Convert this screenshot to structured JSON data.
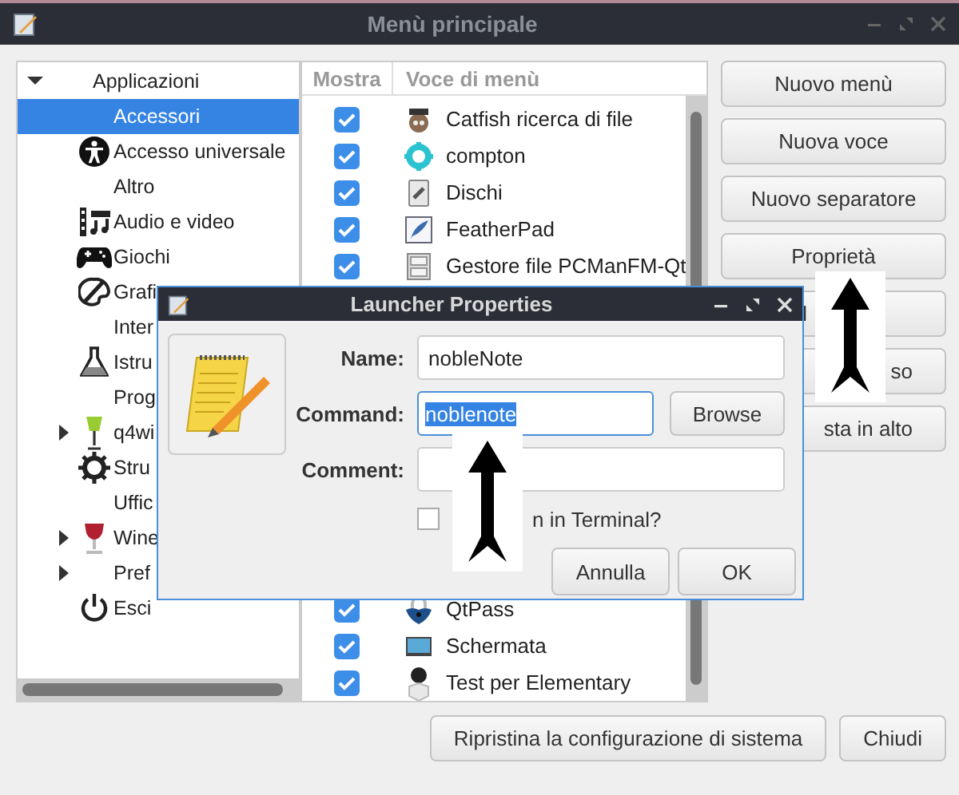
{
  "window": {
    "title": "Menù principale"
  },
  "tree": [
    {
      "label": "Applicazioni",
      "expanded": true,
      "children": [
        {
          "label": "Accessori",
          "selected": true
        },
        {
          "label": "Accesso universale",
          "selected": false
        },
        {
          "label": "Altro",
          "selected": false
        },
        {
          "label": "Audio e video",
          "selected": false
        },
        {
          "label": "Giochi",
          "selected": false
        },
        {
          "label": "Grafi",
          "selected": false
        },
        {
          "label": "Inter",
          "selected": false
        },
        {
          "label": "Istru",
          "selected": false
        },
        {
          "label": "Prog",
          "selected": false
        },
        {
          "label": "q4wi",
          "selected": false,
          "expanded": false
        },
        {
          "label": "Stru",
          "selected": false
        },
        {
          "label": "Uffic",
          "selected": false
        },
        {
          "label": "Wine",
          "selected": false,
          "expanded": false
        },
        {
          "label": "Pref",
          "selected": false,
          "expanded": false
        },
        {
          "label": "Esci",
          "selected": false
        }
      ]
    }
  ],
  "table": {
    "columns": [
      "Mostra",
      "Voce di menù"
    ],
    "rows_top": [
      {
        "label": "Catfish ricerca di file",
        "checked": true
      },
      {
        "label": "compton",
        "checked": true
      },
      {
        "label": "Dischi",
        "checked": true
      },
      {
        "label": "FeatherPad",
        "checked": true
      },
      {
        "label": "Gestore file PCManFM-Qt",
        "checked": true
      }
    ],
    "rows_bottom": [
      {
        "label": "QtPass",
        "checked": true
      },
      {
        "label": "Schermata",
        "checked": true
      },
      {
        "label": "Test per Elementary",
        "checked": true
      }
    ]
  },
  "side_buttons": [
    {
      "label": "Nuovo menù"
    },
    {
      "label": "Nuova voce"
    },
    {
      "label": "Nuovo separatore"
    },
    {
      "label": "Proprietà"
    },
    {
      "label": "l"
    },
    {
      "label": "so"
    },
    {
      "label": "sta in alto"
    }
  ],
  "footer_buttons": [
    "Ripristina la configurazione di sistema",
    "Chiudi"
  ],
  "dialog": {
    "title": "Launcher Properties",
    "name_label": "Name:",
    "name_value": "nobleNote",
    "command_label": "Command:",
    "command_value": "noblenote",
    "browse": "Browse",
    "comment_label": "Comment:",
    "terminal_label": "n in Terminal?",
    "terminal_checked": false,
    "buttons": [
      "Annulla",
      "OK"
    ]
  }
}
